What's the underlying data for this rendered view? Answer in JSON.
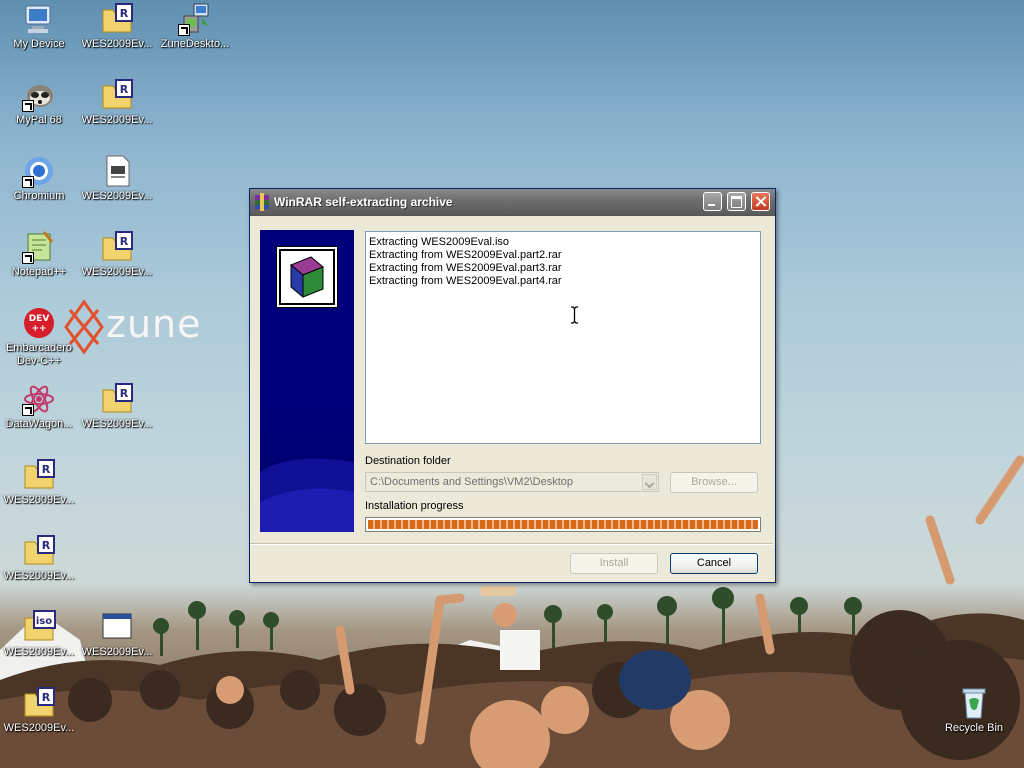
{
  "desktop": {
    "icons": [
      {
        "label": "My Device"
      },
      {
        "label": "WES2009Ev..."
      },
      {
        "label": "ZuneDeskto..."
      },
      {
        "label": "MyPal 68"
      },
      {
        "label": "WES2009Ev..."
      },
      {
        "label": "Chromium"
      },
      {
        "label": "WES2009Ev..."
      },
      {
        "label": "Notepad++"
      },
      {
        "label": "WES2009Ev..."
      },
      {
        "label": "Embarcadero Dev-C++"
      },
      {
        "label": "DataWagon..."
      },
      {
        "label": "WES2009Ev..."
      },
      {
        "label": "WES2009Ev..."
      },
      {
        "label": "WES2009Ev..."
      },
      {
        "label": "WES2009Ev..."
      },
      {
        "label": "WES2009Ev..."
      },
      {
        "label": "WES2009Ev..."
      },
      {
        "label": "Recycle Bin"
      }
    ],
    "wallpaper_text": "zune",
    "devcpp_badge": "DEV ++"
  },
  "window": {
    "title": "WinRAR self-extracting archive",
    "log_lines": [
      "Extracting WES2009Eval.iso",
      "Extracting from WES2009Eval.part2.rar",
      "Extracting from WES2009Eval.part3.rar",
      "Extracting from WES2009Eval.part4.rar"
    ],
    "destination_label": "Destination folder",
    "destination_value": "C:\\Documents and Settings\\VM2\\Desktop",
    "browse_label": "Browse...",
    "progress_label": "Installation progress",
    "progress_value": 1.0,
    "install_label": "Install",
    "cancel_label": "Cancel"
  },
  "icons": {
    "app": "winrar-icon",
    "iso_badge": "iso"
  }
}
